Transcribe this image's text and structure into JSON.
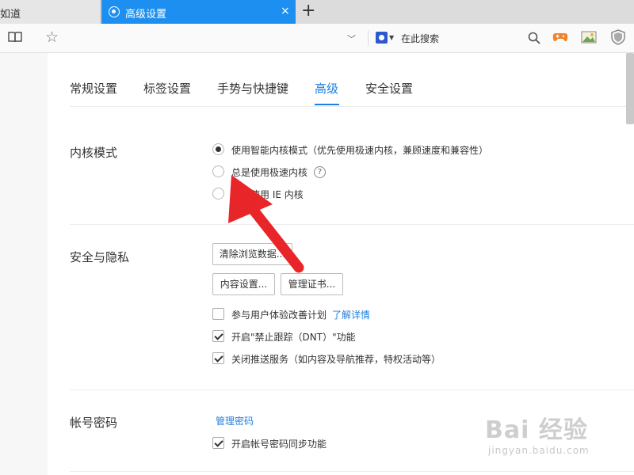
{
  "tabs": {
    "previous_tab_label": "如道",
    "active_tab_label": "高级设置",
    "close_symbol": "×",
    "new_tab_symbol": "+"
  },
  "toolbar": {
    "search_placeholder": "在此搜索"
  },
  "icons": {
    "tab": "settings-gear-icon",
    "reading": "book-icon",
    "bookmark": "star-icon",
    "search_engine": "baidu-paw-icon",
    "search": "search-icon",
    "game": "game-controller-icon",
    "image": "image-icon",
    "security": "shield-icon"
  },
  "colors": {
    "accent": "#1d8ff0",
    "link": "#1d7fe0",
    "annotation_arrow": "#e8262a"
  },
  "settings_nav": {
    "general": "常规设置",
    "tabs": "标签设置",
    "gestures": "手势与快捷键",
    "advanced": "高级",
    "security": "安全设置",
    "active": "高级"
  },
  "kernel": {
    "title": "内核模式",
    "options": [
      {
        "label": "使用智能内核模式（优先使用极速内核，兼顾速度和兼容性）",
        "checked": true
      },
      {
        "label": "总是使用极速内核",
        "checked": false
      },
      {
        "label": "总是使用 IE 内核",
        "checked": false
      }
    ],
    "help_symbol": "?"
  },
  "privacy": {
    "title": "安全与隐私",
    "clear_button": "清除浏览数据...",
    "content_button": "内容设置...",
    "cert_button": "管理证书...",
    "checkboxes": [
      {
        "label": "参与用户体验改善计划",
        "checked": false
      },
      {
        "label": "开启\"禁止跟踪（DNT）\"功能",
        "checked": true
      },
      {
        "label": "关闭推送服务（如内容及导航推荐，特权活动等）",
        "checked": true
      }
    ],
    "learn_more": "了解详情"
  },
  "account": {
    "title": "帐号密码",
    "manage_link": "管理密码",
    "sync_label": "开启帐号密码同步功能",
    "sync_checked": true
  },
  "watermark": {
    "text": "Bai 经验",
    "url": "jingyan.baidu.com"
  }
}
